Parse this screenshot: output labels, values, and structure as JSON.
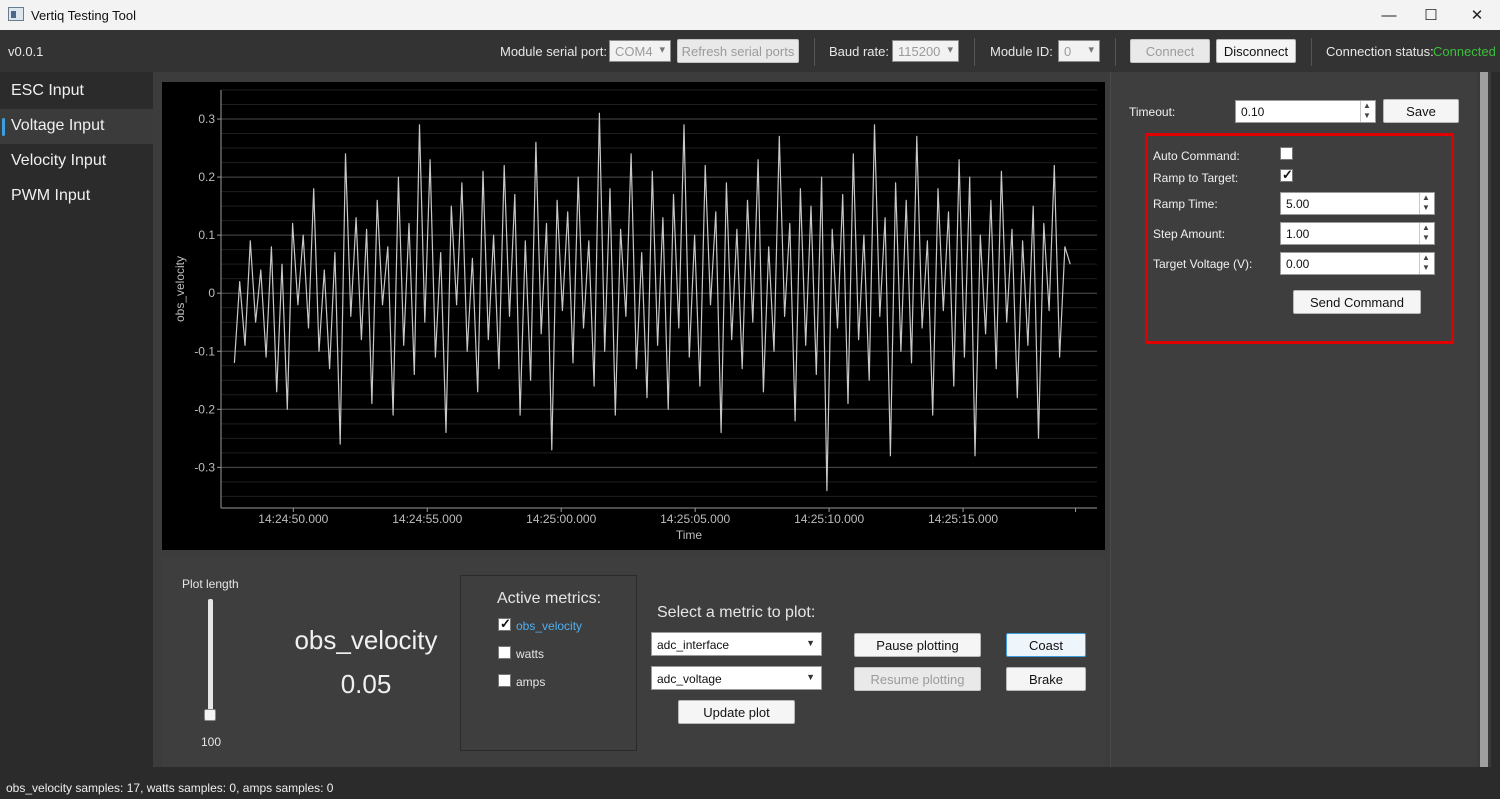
{
  "window": {
    "title": "Vertiq Testing Tool",
    "min_icon": "—",
    "max_icon": "☐",
    "close_icon": "✕"
  },
  "toolbar": {
    "version": "v0.0.1",
    "serial_port_label": "Module serial port:",
    "serial_port_value": "COM4",
    "refresh_label": "Refresh serial ports",
    "baud_label": "Baud rate:",
    "baud_value": "115200",
    "module_id_label": "Module ID:",
    "module_id_value": "0",
    "connect_label": "Connect",
    "disconnect_label": "Disconnect",
    "status_label": "Connection status:",
    "status_value": "Connected",
    "status_color": "#3bbf3b"
  },
  "sidebar": {
    "items": [
      {
        "label": "ESC Input"
      },
      {
        "label": "Voltage Input"
      },
      {
        "label": "Velocity Input"
      },
      {
        "label": "PWM Input"
      }
    ],
    "active_index": 1,
    "accent": "#3e9fe0"
  },
  "chart_data": {
    "type": "line",
    "xlabel": "Time",
    "ylabel": "obs_velocity",
    "ylim": [
      -0.37,
      0.35
    ],
    "yticks": [
      0.3,
      0.2,
      0.1,
      0,
      -0.1,
      -0.2,
      -0.3
    ],
    "yticklabels": [
      "0.3",
      "0.2",
      "0.1",
      "0",
      "-0.1",
      "-0.2",
      "-0.3"
    ],
    "xticklabels": [
      "14:24:50.000",
      "14:24:55.000",
      "14:25:00.000",
      "14:25:05.000",
      "14:25:10.000",
      "14:25:15.000"
    ],
    "xlim_seconds": [
      47.3,
      80.0
    ],
    "xticks_seconds": [
      50,
      55,
      60,
      65,
      70,
      75
    ],
    "grid": true,
    "line_color": "#c8c8c8",
    "series": [
      {
        "values": [
          -0.12,
          0.02,
          -0.09,
          0.09,
          -0.05,
          0.04,
          -0.11,
          0.08,
          -0.17,
          0.05,
          -0.2,
          0.12,
          -0.02,
          0.1,
          -0.06,
          0.18,
          -0.1,
          0.04,
          -0.13,
          0.07,
          -0.26,
          0.24,
          -0.04,
          0.13,
          -0.08,
          0.11,
          -0.19,
          0.16,
          -0.02,
          0.08,
          -0.21,
          0.2,
          -0.09,
          0.12,
          -0.14,
          0.29,
          -0.05,
          0.23,
          -0.11,
          0.07,
          -0.24,
          0.15,
          -0.02,
          0.19,
          -0.1,
          0.06,
          -0.17,
          0.21,
          -0.08,
          0.1,
          -0.13,
          0.22,
          -0.04,
          0.17,
          -0.21,
          0.09,
          -0.15,
          0.26,
          -0.07,
          0.12,
          -0.27,
          0.16,
          -0.03,
          0.14,
          -0.12,
          0.2,
          -0.06,
          0.09,
          -0.16,
          0.31,
          -0.1,
          0.18,
          -0.21,
          0.11,
          -0.04,
          0.24,
          -0.13,
          0.07,
          -0.18,
          0.21,
          -0.09,
          0.13,
          -0.2,
          0.17,
          -0.06,
          0.29,
          -0.11,
          0.1,
          -0.16,
          0.22,
          -0.02,
          0.14,
          -0.24,
          0.19,
          -0.08,
          0.11,
          -0.13,
          0.16,
          -0.05,
          0.23,
          -0.17,
          0.08,
          -0.1,
          0.27,
          -0.04,
          0.12,
          -0.22,
          0.18,
          -0.09,
          0.15,
          -0.14,
          0.2,
          -0.34,
          0.11,
          -0.06,
          0.17,
          -0.19,
          0.24,
          -0.08,
          0.1,
          -0.15,
          0.29,
          -0.04,
          0.13,
          -0.28,
          0.19,
          -0.1,
          0.16,
          -0.12,
          0.27,
          -0.06,
          0.09,
          -0.21,
          0.18,
          -0.03,
          0.14,
          -0.16,
          0.23,
          -0.11,
          0.2,
          -0.28,
          0.1,
          -0.07,
          0.16,
          -0.13,
          0.21,
          -0.05,
          0.11,
          -0.18,
          0.09,
          -0.09,
          0.15,
          -0.25,
          0.12,
          -0.03,
          0.22,
          -0.11,
          0.08,
          0.05
        ]
      }
    ]
  },
  "controls": {
    "plot_length_label": "Plot length",
    "plot_length_value": "100",
    "plot_length_fraction": 0.05,
    "metric_name": "obs_velocity",
    "metric_value": "0.05",
    "active_metrics_title": "Active metrics:",
    "metrics": [
      {
        "label": "obs_velocity",
        "checked": true
      },
      {
        "label": "watts",
        "checked": false
      },
      {
        "label": "amps",
        "checked": false
      }
    ],
    "select_title": "Select a metric to plot:",
    "select_1": "adc_interface",
    "select_2": "adc_voltage",
    "update_label": "Update plot",
    "pause_label": "Pause plotting",
    "resume_label": "Resume plotting",
    "coast_label": "Coast",
    "brake_label": "Brake"
  },
  "right_panel": {
    "timeout_label": "Timeout:",
    "timeout_value": "0.10",
    "save_label": "Save",
    "auto_command_label": "Auto Command:",
    "auto_command_checked": false,
    "ramp_label": "Ramp to Target:",
    "ramp_checked": true,
    "ramp_time_label": "Ramp Time:",
    "ramp_time_value": "5.00",
    "step_label": "Step Amount:",
    "step_value": "1.00",
    "target_label": "Target Voltage (V):",
    "target_value": "0.00",
    "send_label": "Send Command",
    "highlight_color": "#e00000"
  },
  "statusbar": {
    "text": "obs_velocity samples: 17, watts samples: 0, amps samples: 0"
  }
}
